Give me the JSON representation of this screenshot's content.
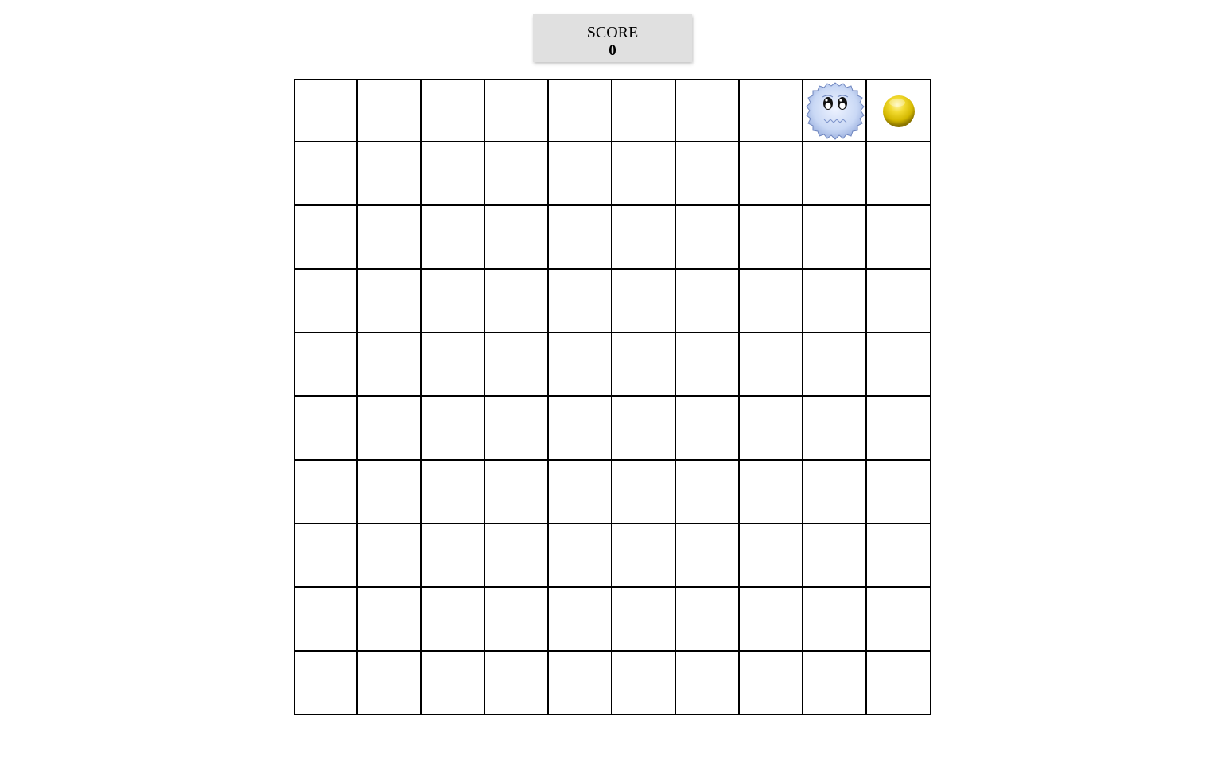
{
  "score": {
    "label": "SCORE",
    "value": "0"
  },
  "board": {
    "rows": 10,
    "cols": 10,
    "player": {
      "row": 0,
      "col": 8,
      "icon": "fluffy-creature-icon"
    },
    "coin": {
      "row": 0,
      "col": 9,
      "icon": "gold-coin-icon"
    }
  },
  "colors": {
    "grid_line": "#000000",
    "score_bg": "#e0e0e0",
    "coin": "#d4b800",
    "creature": "#c9d8f5"
  }
}
